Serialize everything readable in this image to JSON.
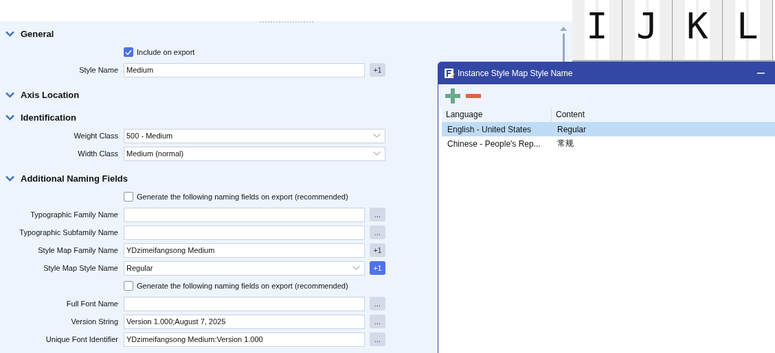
{
  "glyph_strip": [
    {
      "glyph": "I"
    },
    {
      "glyph": "J"
    },
    {
      "glyph": "K"
    },
    {
      "glyph": "L"
    }
  ],
  "sections": [
    {
      "title": "General",
      "expanded": true,
      "rows": [
        {
          "kind": "checkbox",
          "label": "Include on export",
          "checked": true
        },
        {
          "kind": "text",
          "label": "Style Name",
          "value": "Medium",
          "button": {
            "label": "+1",
            "selected": false
          }
        }
      ]
    },
    {
      "title": "Axis Location",
      "expanded": true
    },
    {
      "title": "Identification",
      "expanded": true,
      "rows": [
        {
          "kind": "select",
          "label": "Weight Class",
          "value": "500 - Medium"
        },
        {
          "kind": "select",
          "label": "Width Class",
          "value": "Medium (normal)"
        }
      ]
    },
    {
      "title": "Additional Naming Fields",
      "expanded": true,
      "rows": [
        {
          "kind": "checkbox",
          "label": "Generate the following naming fields on export (recommended)",
          "checked": false
        },
        {
          "kind": "text",
          "label": "Typographic Family Name",
          "button": {
            "label": "...",
            "selected": false
          }
        },
        {
          "kind": "text",
          "label": "Typographic Subfamily Name",
          "button": {
            "label": "...",
            "selected": false
          }
        },
        {
          "kind": "text",
          "label": "Style Map Family Name",
          "value": "YDzimeifangsong Medium",
          "button": {
            "label": "+1",
            "selected": false
          }
        },
        {
          "kind": "select",
          "label": "Style Map Style Name",
          "value": "Regular",
          "button": {
            "label": "+1",
            "selected": true
          }
        },
        {
          "kind": "checkbox",
          "label": "Generate the following naming fields on export (recommended)",
          "checked": false
        },
        {
          "kind": "text",
          "label": "Full Font Name",
          "button": {
            "label": "...",
            "selected": false
          }
        },
        {
          "kind": "text",
          "label": "Version String",
          "value": "Version 1.000;August 7, 2025",
          "button": {
            "label": "...",
            "selected": false
          }
        },
        {
          "kind": "text",
          "label": "Unique Font Identifier",
          "value": "YDzimeifangsong Medium:Version 1.000",
          "button": {
            "label": "...",
            "selected": false
          }
        }
      ]
    }
  ],
  "dialog": {
    "title": "Instance Style Map Style Name",
    "table": {
      "columns": [
        "Language",
        "Content"
      ],
      "rows": [
        {
          "cells": [
            "English - United States",
            "Regular"
          ],
          "selected": true
        },
        {
          "cells": [
            "Chinese - People's Rep...",
            "常规"
          ],
          "selected": false
        }
      ]
    }
  }
}
